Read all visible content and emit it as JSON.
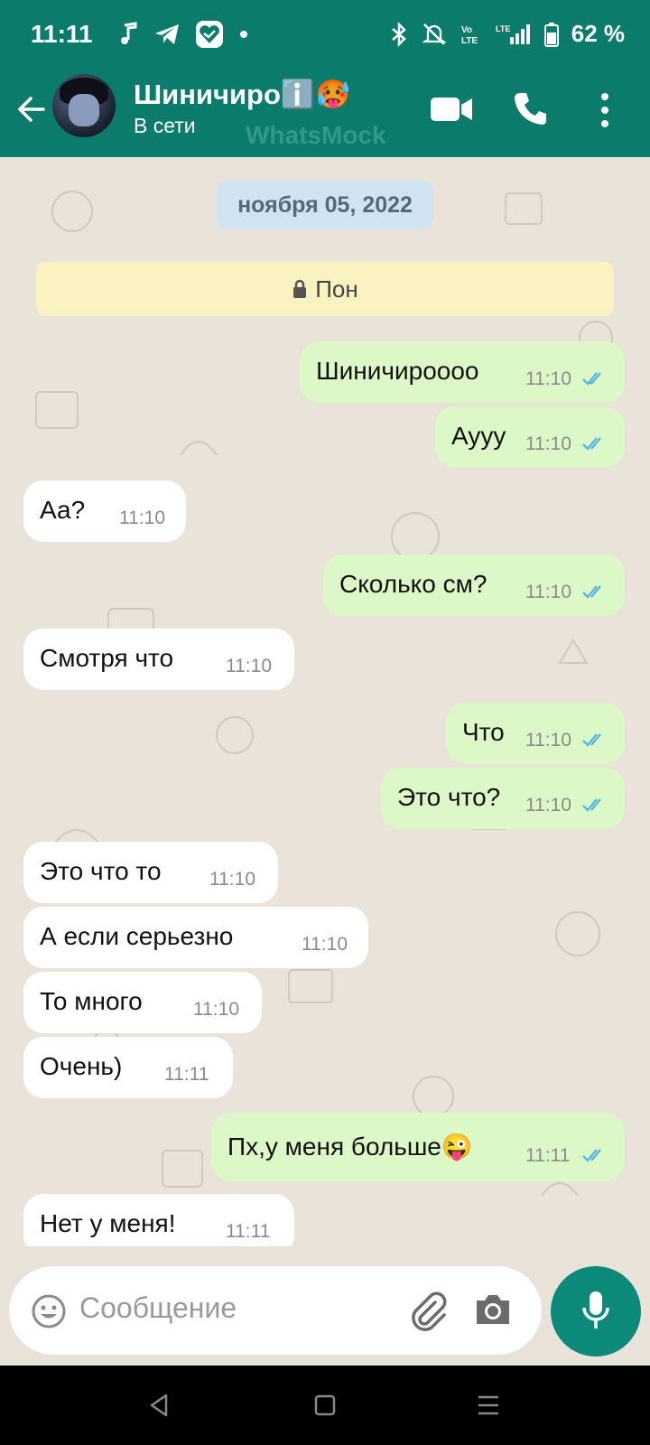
{
  "status_bar": {
    "time": "11:11",
    "battery": "62 %",
    "left_icons": [
      "music-note-icon",
      "telegram-icon",
      "heart-shield-icon",
      "dot-icon"
    ],
    "right_icons": [
      "bluetooth-icon",
      "mute-icon",
      "volte-icon",
      "lte-signal-icon",
      "battery-icon"
    ]
  },
  "header": {
    "contact_name": "Шиничиро",
    "name_emojis": "ℹ️🥵",
    "status": "В сети",
    "watermark": "WhatsMock"
  },
  "chat": {
    "date_chip": "ноября 05, 2022",
    "day_chip": "Пон",
    "messages": [
      {
        "dir": "out",
        "text": "Шиничироооо",
        "time": "11:10"
      },
      {
        "dir": "out",
        "text": "Аууу",
        "time": "11:10"
      },
      {
        "dir": "in",
        "text": "Аа?",
        "time": "11:10"
      },
      {
        "dir": "out",
        "text": "Сколько см?",
        "time": "11:10"
      },
      {
        "dir": "in",
        "text": "Смотря что",
        "time": "11:10"
      },
      {
        "dir": "out",
        "text": "Что",
        "time": "11:10"
      },
      {
        "dir": "out",
        "text": "Это что?",
        "time": "11:10"
      },
      {
        "dir": "in",
        "text": "Это что то",
        "time": "11:10"
      },
      {
        "dir": "in",
        "text": "А если серьезно",
        "time": "11:10"
      },
      {
        "dir": "in",
        "text": "То много",
        "time": "11:10"
      },
      {
        "dir": "in",
        "text": "Очень)",
        "time": "11:11"
      },
      {
        "dir": "out",
        "text": "Пх,у меня больше😜",
        "time": "11:11"
      },
      {
        "dir": "in",
        "text": "Нет у меня!",
        "time": "11:11"
      }
    ]
  },
  "input": {
    "placeholder": "Сообщение"
  },
  "colors": {
    "header": "#0b7c6c",
    "outgoing_bubble": "#dcf8c6",
    "incoming_bubble": "#ffffff",
    "read_tick": "#4fb3e6"
  }
}
